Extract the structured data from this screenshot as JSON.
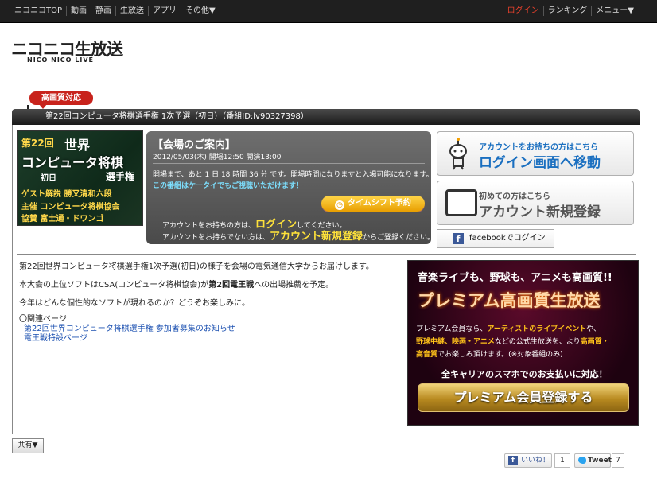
{
  "topbar": {
    "nav": [
      "ニコニコTOP",
      "動画",
      "静画",
      "生放送",
      "アプリ",
      "その他▼"
    ],
    "right": [
      "ログイン",
      "ランキング",
      "メニュー▼"
    ]
  },
  "logo": {
    "main": "ニコニコ生放送",
    "sub": "NICO NICO LIVE"
  },
  "badge": "高画質対応",
  "title": "第22回コンピュータ将棋選手権 1次予選（初日）（番組ID:lv90327398）",
  "thumbnail": {
    "lines": [
      "第22回",
      "世界",
      "コンピュータ将棋",
      "初日",
      "選手権",
      "ゲスト解説 勝又清和六段",
      "主催 コンピュータ将棋協会",
      "協賛 富士通・ドワンゴ"
    ]
  },
  "venue": {
    "heading": "【会場のご案内】",
    "datetime": "2012/05/03(木) 開場12:50 開演13:00",
    "countdown": "開場まで、あと 1 日 18 時間 36 分 です。開場時間になりますと入場可能になります。",
    "mobile": "この番組はケータイでもご視聴いただけます！",
    "timeshift": "タイムシフト予約",
    "account_have_pre": "アカウントをお持ちの方は、",
    "account_have_link": "ログイン",
    "account_have_post": "してください。",
    "account_none_pre": "アカウントをお持ちでない方は、",
    "account_none_link": "アカウント新規登録",
    "account_none_post": "からご登録ください。"
  },
  "side": {
    "login_small": "アカウントをお持ちの方はこちら",
    "login_big": "ログイン画面へ移動",
    "register_small": "初めての方はこちら",
    "register_big": "アカウント新規登録",
    "facebook": "facebookでログイン"
  },
  "description": {
    "line1": "第22回世界コンピュータ将棋選手権1次予選(初日)の様子を会場の電気通信大学からお届けします。",
    "line2_pre": "本大会の上位ソフトはCSA(コンピュータ将棋協会)が",
    "line2_bold": "第2回電王戦",
    "line2_post": "への出場推薦を予定。",
    "line3": "今年はどんな個性的なソフトが現れるのか？どうぞお楽しみに。",
    "related_label": "〇関連ページ",
    "links": [
      "第22回世界コンピュータ将棋選手権 参加者募集のお知らせ",
      "電王戦特設ページ"
    ]
  },
  "ad": {
    "line1": "音楽ライブも、野球も、アニメも高画質!!",
    "line2": "プレミアム高画質生放送",
    "line3_pre": "プレミアム会員なら、",
    "line3_hl": "アーティストのライブイベント",
    "line3_post": "や、",
    "line4_hl": "野球中継、映画・アニメ",
    "line4_post": "などの公式生放送を、より",
    "line4_hl2": "高画質・",
    "line5_hl": "高音質",
    "line5_post": "でお楽しみ頂けます。(※対象番組のみ)",
    "line6": "全キャリアのスマホでのお支払いに対応！",
    "button": "プレミアム会員登録する"
  },
  "share": "共有▼",
  "social": {
    "like": "いいね！",
    "like_count": "1",
    "tweet": "Tweet",
    "tweet_count": "7"
  },
  "colors": {
    "accent_red": "#c8231c",
    "link_blue": "#1a6fc0",
    "highlight_yellow": "#ffe23a"
  }
}
